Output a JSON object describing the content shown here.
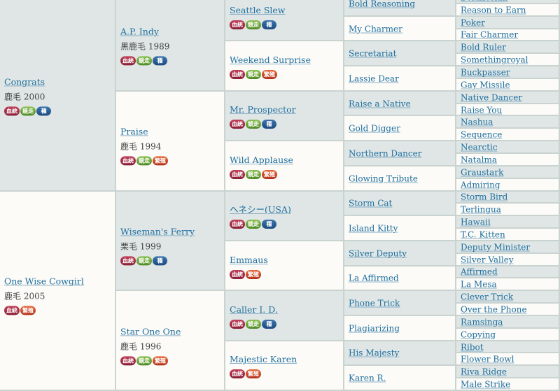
{
  "badges": {
    "blood": "血統",
    "race": "競走",
    "stud": "種",
    "brood": "繁殖"
  },
  "colors": {
    "male_bg": "#dfe6e5",
    "female_bg": "#fcfbf7",
    "link": "#1e6fa0",
    "badge_blood": "#a32b45",
    "badge_race": "#6ba53b",
    "badge_stud": "#2a5f96",
    "badge_brood": "#cc4a28"
  },
  "gen1": [
    {
      "name": "Congrats",
      "info": "鹿毛 2000",
      "badges": [
        "blood",
        "race",
        "stud"
      ]
    },
    {
      "name": "One Wise Cowgirl",
      "info": "鹿毛 2005",
      "badges": [
        "blood",
        "brood"
      ]
    }
  ],
  "gen2": [
    {
      "name": "A.P. Indy",
      "info": "黒鹿毛 1989",
      "badges": [
        "blood",
        "race",
        "stud"
      ]
    },
    {
      "name": "Praise",
      "info": "鹿毛 1994",
      "badges": [
        "blood",
        "race",
        "brood"
      ]
    },
    {
      "name": "Wiseman's Ferry",
      "info": "栗毛 1999",
      "badges": [
        "blood",
        "race",
        "stud"
      ]
    },
    {
      "name": "Star One One",
      "info": "鹿毛 1996",
      "badges": [
        "blood",
        "race",
        "brood"
      ]
    }
  ],
  "gen3": [
    {
      "name": "Seattle Slew",
      "badges": [
        "blood",
        "race",
        "stud"
      ]
    },
    {
      "name": "Weekend Surprise",
      "badges": [
        "blood",
        "race",
        "brood"
      ]
    },
    {
      "name": "Mr. Prospector",
      "badges": [
        "blood",
        "race",
        "stud"
      ]
    },
    {
      "name": "Wild Applause",
      "badges": [
        "blood",
        "race",
        "brood"
      ]
    },
    {
      "name": "ヘネシー(USA)",
      "badges": [
        "blood",
        "race",
        "stud"
      ]
    },
    {
      "name": "Emmaus",
      "badges": [
        "blood",
        "brood"
      ]
    },
    {
      "name": "Caller I. D.",
      "badges": [
        "blood",
        "race",
        "stud"
      ]
    },
    {
      "name": "Majestic Karen",
      "badges": [
        "blood",
        "brood"
      ]
    }
  ],
  "gen4": [
    "Bold Reasoning",
    "My Charmer",
    "Secretariat",
    "Lassie Dear",
    "Raise a Native",
    "Gold Digger",
    "Northern Dancer",
    "Glowing Tribute",
    "Storm Cat",
    "Island Kitty",
    "Silver Deputy",
    "La Affirmed",
    "Phone Trick",
    "Plagiarizing",
    "His Majesty",
    "Karen R."
  ],
  "gen5": [
    "Boldnesian",
    "Reason to Earn",
    "Poker",
    "Fair Charmer",
    "Bold Ruler",
    "Somethingroyal",
    "Buckpasser",
    "Gay Missile",
    "Native Dancer",
    "Raise You",
    "Nashua",
    "Sequence",
    "Nearctic",
    "Natalma",
    "Graustark",
    "Admiring",
    "Storm Bird",
    "Terlingua",
    "Hawaii",
    "T.C. Kitten",
    "Deputy Minister",
    "Silver Valley",
    "Affirmed",
    "La Mesa",
    "Clever Trick",
    "Over the Phone",
    "Ramsinga",
    "Copying",
    "Ribot",
    "Flower Bowl",
    "Riva Ridge",
    "Male Strike"
  ]
}
